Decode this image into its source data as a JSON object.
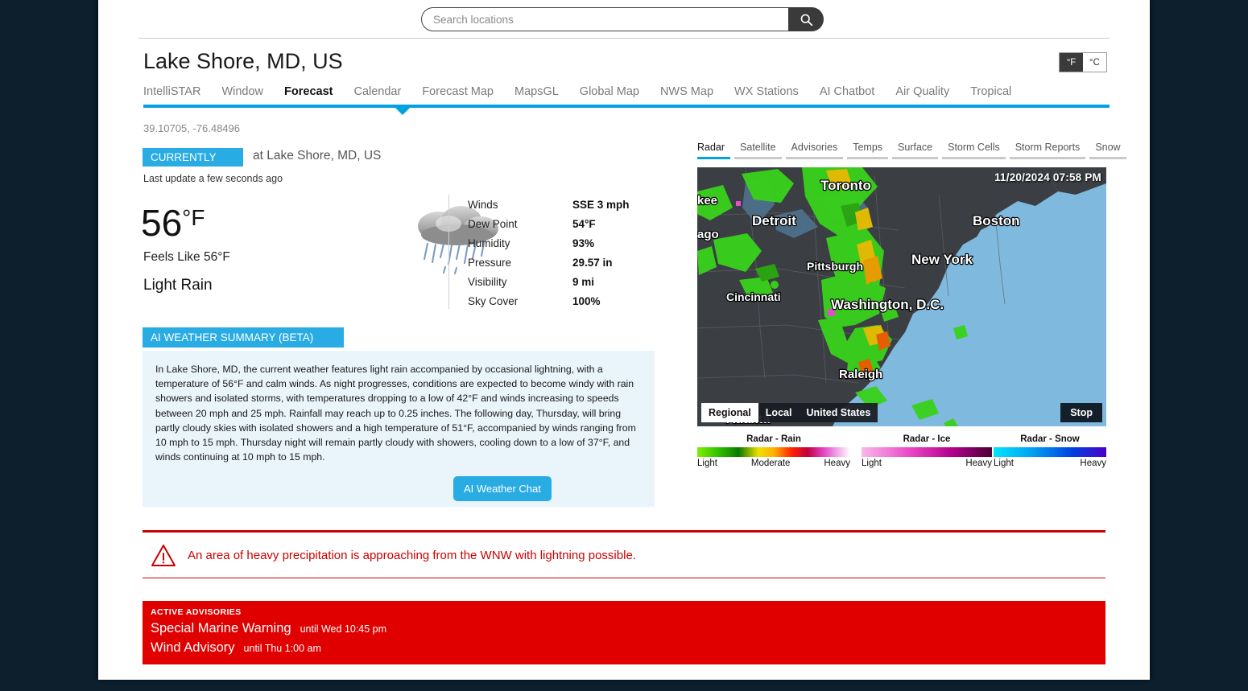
{
  "search": {
    "placeholder": "Search locations",
    "value": "",
    "icon": "search-icon"
  },
  "header": {
    "title": "Lake Shore, MD, US",
    "coords": "39.10705, -76.48496",
    "units": [
      {
        "label": "°F",
        "active": true
      },
      {
        "label": "°C",
        "active": false
      }
    ]
  },
  "tabs": [
    {
      "label": "IntelliSTAR",
      "active": false
    },
    {
      "label": "Window",
      "active": false
    },
    {
      "label": "Forecast",
      "active": true
    },
    {
      "label": "Calendar",
      "active": false
    },
    {
      "label": "Forecast Map",
      "active": false
    },
    {
      "label": "MapsGL",
      "active": false
    },
    {
      "label": "Global Map",
      "active": false
    },
    {
      "label": "NWS Map",
      "active": false
    },
    {
      "label": "WX Stations",
      "active": false
    },
    {
      "label": "AI Chatbot",
      "active": false
    },
    {
      "label": "Air Quality",
      "active": false
    },
    {
      "label": "Tropical",
      "active": false
    }
  ],
  "current": {
    "badge": "CURRENTLY",
    "at_location": "at Lake Shore, MD, US",
    "last_update": "Last update a few seconds ago",
    "temperature": "56",
    "temperature_unit": "°F",
    "feels_like": "Feels Like 56°F",
    "condition": "Light Rain",
    "icon": "rain-cloud-icon",
    "metrics": [
      {
        "label": "Winds",
        "value": "SSE 3 mph"
      },
      {
        "label": "Dew Point",
        "value": "54°F"
      },
      {
        "label": "Humidity",
        "value": "93%"
      },
      {
        "label": "Pressure",
        "value": "29.57 in"
      },
      {
        "label": "Visibility",
        "value": "9 mi"
      },
      {
        "label": "Sky Cover",
        "value": "100%"
      }
    ]
  },
  "ai_summary": {
    "badge": "AI WEATHER SUMMARY (BETA)",
    "text": "In Lake Shore, MD, the current weather features light rain accompanied by occasional lightning, with a temperature of 56°F and calm winds. As night progresses, conditions are expected to become windy with rain showers and isolated storms, with temperatures dropping to a low of 42°F and winds increasing to speeds between 20 mph and 25 mph. Rainfall may reach up to 0.25 inches. The following day, Thursday, will bring partly cloudy skies with isolated showers and a high temperature of 51°F, accompanied by winds ranging from 10 mph to 15 mph. Thursday night will remain partly cloudy with showers, cooling down to a low of 37°F, and winds continuing at 10 mph to 15 mph.",
    "chat_button": "AI Weather Chat"
  },
  "radar": {
    "layer_tabs": [
      {
        "label": "Radar",
        "active": true
      },
      {
        "label": "Satellite",
        "active": false
      },
      {
        "label": "Advisories",
        "active": false
      },
      {
        "label": "Temps",
        "active": false
      },
      {
        "label": "Surface",
        "active": false
      },
      {
        "label": "Storm Cells",
        "active": false
      },
      {
        "label": "Storm Reports",
        "active": false
      },
      {
        "label": "Snow",
        "active": false
      }
    ],
    "timestamp": "11/20/2024 07:58 PM",
    "scope_buttons": [
      {
        "label": "Regional",
        "active": true
      },
      {
        "label": "Local",
        "active": false
      },
      {
        "label": "United States",
        "active": false
      }
    ],
    "stop_button": "Stop",
    "city_labels": [
      "Toronto",
      "Detroit",
      "Boston",
      "Pittsburgh",
      "New York",
      "Cincinnati",
      "Washington, D.C.",
      "Raleigh",
      "kee",
      "ago",
      "Atlanta"
    ],
    "legends": [
      {
        "title": "Radar - Rain",
        "low": "Light",
        "mid": "Moderate",
        "high": "Heavy"
      },
      {
        "title": "Radar - Ice",
        "low": "Light",
        "high": "Heavy"
      },
      {
        "title": "Radar - Snow",
        "low": "Light",
        "high": "Heavy"
      }
    ]
  },
  "precip_alert": {
    "icon": "warning-triangle-icon",
    "text": "An area of heavy precipitation is approaching from the WNW with lightning possible."
  },
  "advisories": {
    "heading": "ACTIVE ADVISORIES",
    "items": [
      {
        "name": "Special Marine Warning",
        "until": "until Wed 10:45 pm"
      },
      {
        "name": "Wind Advisory",
        "until": "until Thu 1:00 am"
      }
    ]
  },
  "colors": {
    "accent": "#00a3e0",
    "badge": "#29ace3",
    "alert_red": "#cc0000",
    "advisory_red": "#e00000",
    "page_bg": "#0d1f2d"
  }
}
